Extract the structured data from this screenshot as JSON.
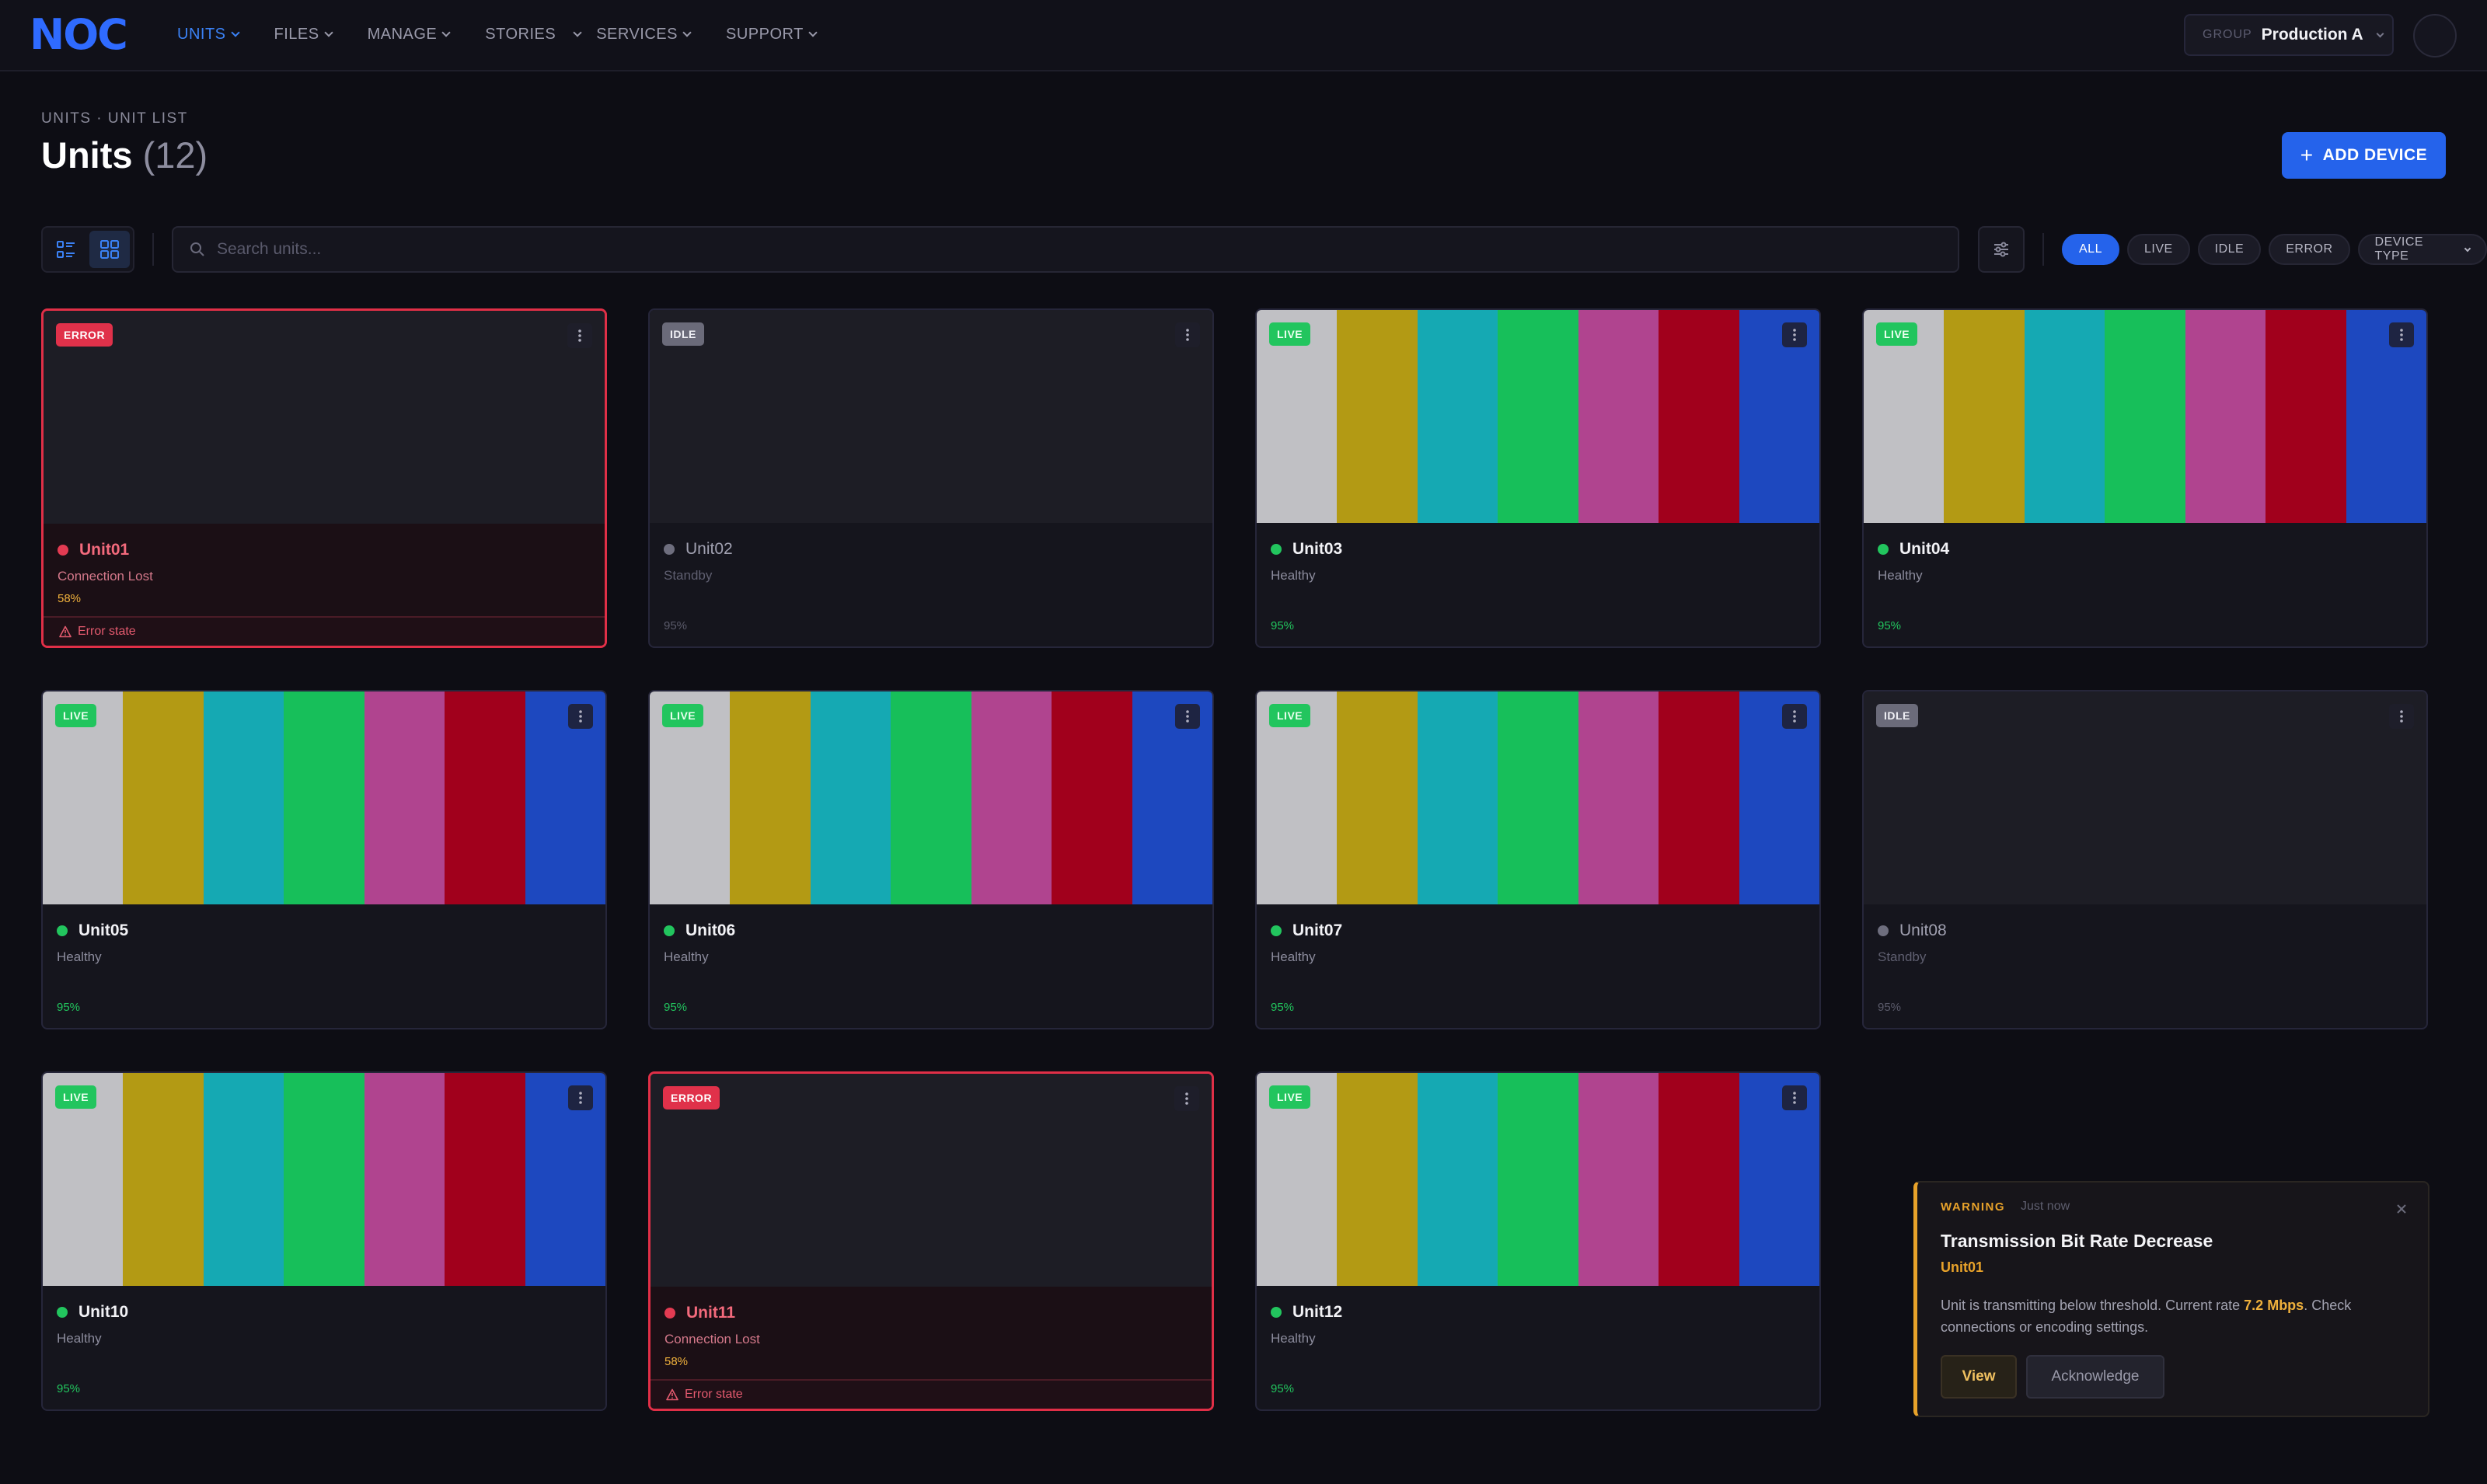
{
  "app": {
    "logo": "NOC"
  },
  "nav": {
    "items": [
      {
        "label": "UNITS",
        "active": true
      },
      {
        "label": "FILES"
      },
      {
        "label": "MANAGE"
      },
      {
        "label": "STORIES"
      },
      {
        "label": "SERVICES"
      },
      {
        "label": "SUPPORT"
      }
    ]
  },
  "group": {
    "label": "GROUP",
    "value": "Production A"
  },
  "header": {
    "breadcrumb": "UNITS · UNIT LIST",
    "title": "Units",
    "count": "(12)",
    "add_label": "ADD DEVICE"
  },
  "toolbar": {
    "search_placeholder": "Search units...",
    "view_modes": [
      "list",
      "grid"
    ],
    "active_view": "grid",
    "filters": [
      {
        "label": "ALL",
        "active": true
      },
      {
        "label": "LIVE"
      },
      {
        "label": "IDLE"
      },
      {
        "label": "ERROR"
      },
      {
        "label": "DEVICE TYPE",
        "dropdown": true
      }
    ]
  },
  "colors": {
    "accent": "#2563eb",
    "live": "#22c55e",
    "idle": "#6b6b7a",
    "error": "#e0314a",
    "warning": "#e8a22a",
    "color_bars": [
      "#c0c0c4",
      "#b39a14",
      "#15a9b3",
      "#17bf5a",
      "#b0448f",
      "#a1001c",
      "#1d48bf"
    ]
  },
  "units": [
    {
      "name": "Unit01",
      "status": "error",
      "badge": "ERROR",
      "status_text": "Connection Lost",
      "pct": "58%",
      "error_label": "Error state"
    },
    {
      "name": "Unit02",
      "status": "idle",
      "badge": "IDLE",
      "status_text": "Standby",
      "pct": "95%"
    },
    {
      "name": "Unit03",
      "status": "live",
      "badge": "LIVE",
      "status_text": "Healthy",
      "pct": "95%"
    },
    {
      "name": "Unit04",
      "status": "live",
      "badge": "LIVE",
      "status_text": "Healthy",
      "pct": "95%"
    },
    {
      "name": "Unit05",
      "status": "live",
      "badge": "LIVE",
      "status_text": "Healthy",
      "pct": "95%"
    },
    {
      "name": "Unit06",
      "status": "live",
      "badge": "LIVE",
      "status_text": "Healthy",
      "pct": "95%"
    },
    {
      "name": "Unit07",
      "status": "live",
      "badge": "LIVE",
      "status_text": "Healthy",
      "pct": "95%"
    },
    {
      "name": "Unit08",
      "status": "idle",
      "badge": "IDLE",
      "status_text": "Standby",
      "pct": "95%"
    },
    {
      "name": "Unit10",
      "status": "live",
      "badge": "LIVE",
      "status_text": "Healthy",
      "pct": "95%"
    },
    {
      "name": "Unit11",
      "status": "error",
      "badge": "ERROR",
      "status_text": "Connection Lost",
      "pct": "58%",
      "error_label": "Error state"
    },
    {
      "name": "Unit12",
      "status": "live",
      "badge": "LIVE",
      "status_text": "Healthy",
      "pct": "95%"
    }
  ],
  "toast": {
    "level": "WARNING",
    "time": "Just now",
    "title": "Transmission Bit Rate Decrease",
    "unit": "Unit01",
    "message_pre": "Unit is transmitting below threshold. Current rate ",
    "rate": "7.2 Mbps",
    "message_post": ". Check connections or encoding settings.",
    "view_label": "View",
    "ack_label": "Acknowledge"
  }
}
